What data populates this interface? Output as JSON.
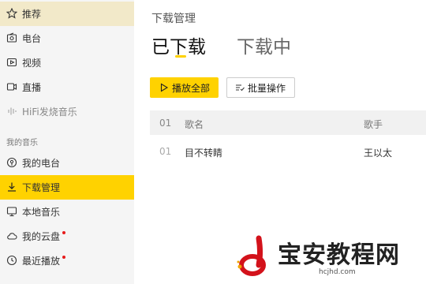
{
  "sidebar": {
    "items": [
      {
        "label": "推荐",
        "icon": "star-icon"
      },
      {
        "label": "电台",
        "icon": "radio-icon"
      },
      {
        "label": "视频",
        "icon": "video-icon"
      },
      {
        "label": "直播",
        "icon": "live-icon"
      },
      {
        "label": "HiFi发烧音乐",
        "icon": "hifi-icon"
      }
    ],
    "section_title": "我的音乐",
    "my_items": [
      {
        "label": "我的电台",
        "icon": "podcast-icon"
      },
      {
        "label": "下载管理",
        "icon": "download-icon"
      },
      {
        "label": "本地音乐",
        "icon": "monitor-icon"
      },
      {
        "label": "我的云盘",
        "icon": "cloud-icon"
      },
      {
        "label": "最近播放",
        "icon": "clock-icon"
      }
    ]
  },
  "main": {
    "page_title": "下载管理",
    "tabs": [
      {
        "label": "已下载"
      },
      {
        "label": "下载中"
      }
    ],
    "buttons": {
      "play_all": "播放全部",
      "batch": "批量操作"
    },
    "table": {
      "headers": {
        "index": "01",
        "title": "歌名",
        "artist": "歌手"
      },
      "rows": [
        {
          "index": "01",
          "title": "目不转睛",
          "artist": "王以太"
        }
      ]
    }
  },
  "watermark": {
    "text": "宝安教程网",
    "url": "hcjhd.com"
  },
  "colors": {
    "accent": "#ffd200",
    "sidebar_bg": "#f5f5f5",
    "active_top_bg": "#f2e9c9",
    "notify_dot": "#e61b1b"
  }
}
